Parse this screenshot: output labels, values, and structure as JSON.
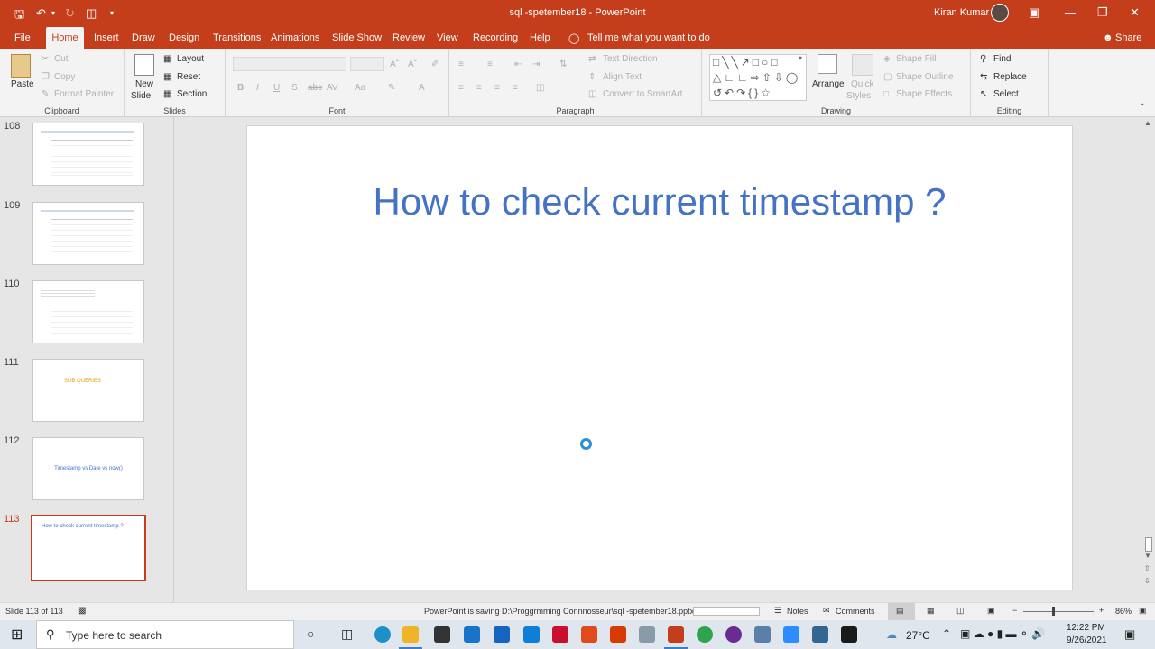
{
  "window": {
    "title": "sql -spetember18 - PowerPoint",
    "user": "Kiran Kumar",
    "accent": "#c43e1c"
  },
  "quick_access": {
    "save_icon": "save-icon",
    "undo_icon": "undo-icon",
    "redo_icon": "redo-icon",
    "present_icon": "present-icon"
  },
  "ribbon_tabs": [
    "File",
    "Home",
    "Insert",
    "Draw",
    "Design",
    "Transitions",
    "Animations",
    "Slide Show",
    "Review",
    "View",
    "Recording",
    "Help"
  ],
  "tell_me": "Tell me what you want to do",
  "share": "Share",
  "clipboard": {
    "paste": "Paste",
    "cut": "Cut",
    "copy": "Copy",
    "format_painter": "Format Painter",
    "label": "Clipboard"
  },
  "slides_group": {
    "new_slide": "New",
    "new_slide2": "Slide",
    "layout": "Layout",
    "reset": "Reset",
    "section": "Section",
    "label": "Slides"
  },
  "font_group": {
    "label": "Font",
    "bold": "B",
    "italic": "I",
    "underline": "U",
    "shadow": "S",
    "strike": "abc",
    "spacing": "AV",
    "case": "Aa",
    "color": "A"
  },
  "paragraph": {
    "text_direction": "Text Direction",
    "align_text": "Align Text",
    "convert": "Convert to SmartArt",
    "label": "Paragraph"
  },
  "drawing": {
    "arrange": "Arrange",
    "quick_styles": "Quick",
    "quick_styles2": "Styles",
    "shape_fill": "Shape Fill",
    "shape_outline": "Shape Outline",
    "shape_effects": "Shape Effects",
    "label": "Drawing"
  },
  "editing": {
    "find": "Find",
    "replace": "Replace",
    "select": "Select",
    "label": "Editing"
  },
  "thumbnails": [
    {
      "num": "108"
    },
    {
      "num": "109"
    },
    {
      "num": "110"
    },
    {
      "num": "111",
      "text": "SUB QUERIES"
    },
    {
      "num": "112",
      "text": "Timestamp vs Date vs now()"
    },
    {
      "num": "113",
      "text": "How to check current timestamp ?"
    }
  ],
  "slide": {
    "title": "How to check current timestamp ?"
  },
  "status": {
    "slide_count": "Slide 113 of 113",
    "saving": "PowerPoint is saving D:\\Proggrmming Connnosseur\\sql -spetember18.pptx.",
    "notes": "Notes",
    "comments": "Comments",
    "zoom": "86%"
  },
  "taskbar": {
    "search": "Type here to search",
    "temp": "27°C",
    "time": "12:22 PM",
    "date": "9/26/2021"
  }
}
